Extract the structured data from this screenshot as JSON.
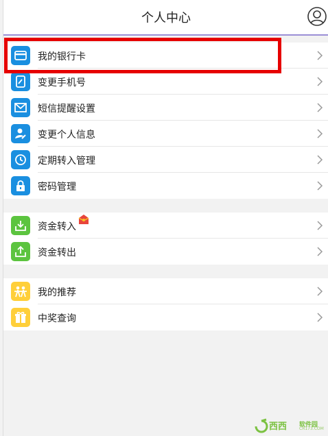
{
  "header": {
    "title": "个人中心"
  },
  "groups": [
    {
      "items": [
        {
          "label": "我的银行卡",
          "icon": "bank-card-icon"
        },
        {
          "label": "变更手机号",
          "icon": "phone-edit-icon"
        },
        {
          "label": "短信提醒设置",
          "icon": "envelope-icon"
        },
        {
          "label": "变更个人信息",
          "icon": "user-edit-icon"
        },
        {
          "label": "定期转入管理",
          "icon": "clock-icon"
        },
        {
          "label": "密码管理",
          "icon": "lock-icon"
        }
      ]
    },
    {
      "items": [
        {
          "label": "资金转入",
          "icon": "download-tray-icon",
          "badge": "red-envelope-icon"
        },
        {
          "label": "资金转出",
          "icon": "upload-tray-icon"
        }
      ]
    },
    {
      "items": [
        {
          "label": "我的推荐",
          "icon": "people-recommend-icon"
        },
        {
          "label": "中奖查询",
          "icon": "gift-icon"
        }
      ]
    }
  ],
  "watermark": {
    "brand": "西西",
    "sub": "软件园",
    "url": "CR173.COM"
  },
  "colors": {
    "accent": "#1a8fe0",
    "green": "#5cc43f",
    "yellow": "#ffcf3a",
    "highlight": "#e60000",
    "headerLine": "#9b8fd6"
  }
}
